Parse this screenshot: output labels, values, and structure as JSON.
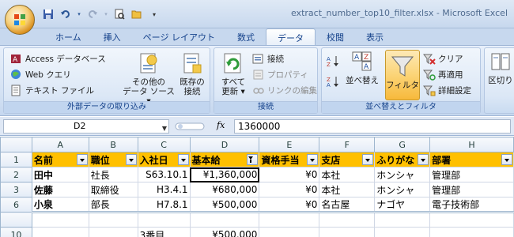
{
  "window": {
    "title": "extract_number_top10_filter.xlsx - Microsoft Excel"
  },
  "quick_access": {
    "icons": [
      "save-icon",
      "undo-icon",
      "redo-icon",
      "print-preview-icon",
      "open-icon",
      "customize-icon"
    ]
  },
  "ribbon_tabs": [
    {
      "label": "ホーム"
    },
    {
      "label": "挿入"
    },
    {
      "label": "ページ レイアウト"
    },
    {
      "label": "数式"
    },
    {
      "label": "データ",
      "active": true
    },
    {
      "label": "校閲"
    },
    {
      "label": "表示"
    }
  ],
  "ribbon": {
    "external": {
      "access": "Access データベース",
      "web": "Web クエリ",
      "text": "テキスト ファイル",
      "other1": "その他の",
      "other2": "データ ソース ▾",
      "label": "外部データの取り込み"
    },
    "connections": {
      "existing1": "既存の",
      "existing2": "接続",
      "refresh1": "すべて",
      "refresh2": "更新 ▾",
      "connections": "接続",
      "properties": "プロパティ",
      "edit_links": "リンクの編集",
      "label": "接続"
    },
    "sort_filter": {
      "sort": "並べ替え",
      "filter": "フィルタ",
      "clear": "クリア",
      "reapply": "再適用",
      "advanced": "詳細設定",
      "label": "並べ替えとフィルタ"
    },
    "data_tools": {
      "text_to_columns": "区切り"
    }
  },
  "formula_bar": {
    "name_box": "D2",
    "fx": "fx",
    "formula": "1360000"
  },
  "sheet": {
    "columns": [
      "A",
      "B",
      "C",
      "D",
      "E",
      "F",
      "G",
      "H"
    ],
    "headers": [
      "名前",
      "職位",
      "入社日",
      "基本給",
      "資格手当",
      "支店",
      "ふりがな",
      "部署"
    ],
    "rows": [
      {
        "num": "2",
        "cells": [
          "田中",
          "社長",
          "S63.10.1",
          "¥1,360,000",
          "¥0",
          "本社",
          "ホンシャ",
          "管理部"
        ]
      },
      {
        "num": "3",
        "cells": [
          "佐藤",
          "取締役",
          "H3.4.1",
          "¥680,000",
          "¥0",
          "本社",
          "ホンシャ",
          "管理部"
        ]
      },
      {
        "num": "6",
        "cells": [
          "小泉",
          "部長",
          "H7.8.1",
          "¥500,000",
          "¥0",
          "名古屋",
          "ナゴヤ",
          "電子技術部"
        ]
      },
      {
        "num": "",
        "cells": [
          "",
          "",
          "",
          "",
          "",
          "",
          "",
          ""
        ]
      },
      {
        "num": "10",
        "cells": [
          "",
          "",
          "3番目",
          "¥500,000",
          "",
          "",
          "",
          ""
        ]
      }
    ],
    "header_row_num": "1"
  },
  "colors": {
    "header_fill": "#ffc000",
    "ribbon_text": "#15428b"
  }
}
